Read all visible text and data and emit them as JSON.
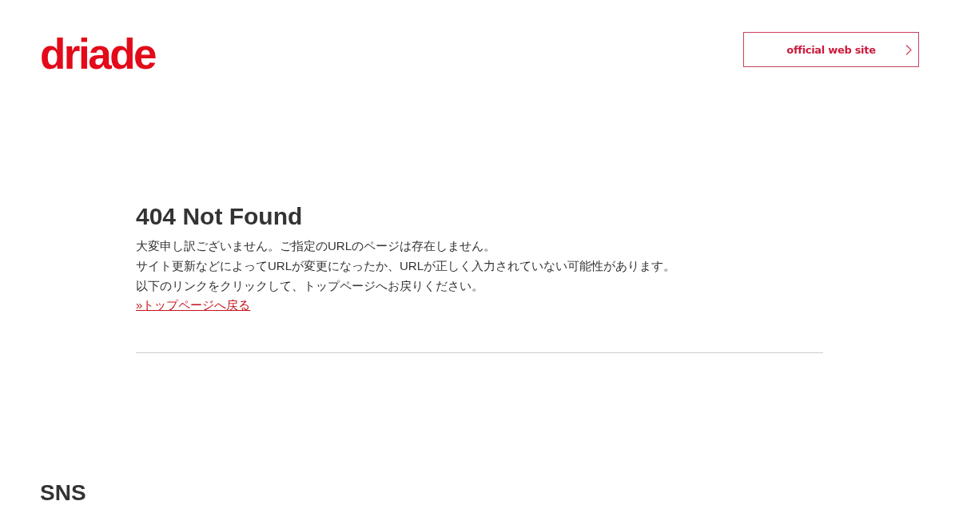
{
  "header": {
    "logo": "driade",
    "official_link": "official web site"
  },
  "main": {
    "title": "404 Not Found",
    "lines": [
      "大変申し訳ございません。ご指定のURLのページは存在しません。",
      "サイト更新などによってURLが変更になったか、URLが正しく入力されていない可能性があります。",
      "以下のリンクをクリックして、トップページへお戻りください。"
    ],
    "link": "»トップページへ戻る"
  },
  "footer": {
    "heading": "SNS"
  }
}
